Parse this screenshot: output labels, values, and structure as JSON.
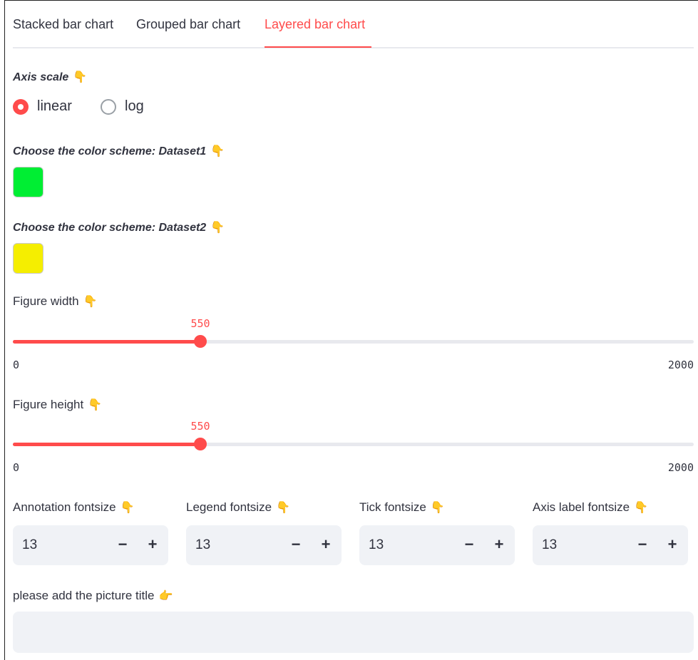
{
  "tabs": [
    {
      "label": "Stacked bar chart",
      "active": false
    },
    {
      "label": "Grouped bar chart",
      "active": false
    },
    {
      "label": "Layered bar chart",
      "active": true
    }
  ],
  "axis_scale": {
    "label": "Axis scale",
    "options": [
      "linear",
      "log"
    ],
    "selected": "linear"
  },
  "color_dataset1": {
    "label": "Choose the color scheme: Dataset1",
    "color": "#00ee33"
  },
  "color_dataset2": {
    "label": "Choose the color scheme: Dataset2",
    "color": "#f5ee00"
  },
  "figure_width": {
    "label": "Figure width",
    "value": 550,
    "min": 0,
    "max": 2000
  },
  "figure_height": {
    "label": "Figure height",
    "value": 550,
    "min": 0,
    "max": 2000
  },
  "number_inputs": [
    {
      "label": "Annotation fontsize",
      "value": "13",
      "minus": "−",
      "plus": "+"
    },
    {
      "label": "Legend fontsize",
      "value": "13",
      "minus": "−",
      "plus": "+"
    },
    {
      "label": "Tick fontsize",
      "value": "13",
      "minus": "−",
      "plus": "+"
    },
    {
      "label": "Axis label fontsize",
      "value": "13",
      "minus": "−",
      "plus": "+"
    }
  ],
  "title_input": {
    "label": "please add the picture title",
    "value": ""
  },
  "icons": {
    "label_pointer": "pointing-down-hand-icon",
    "title_pointer": "pointing-right-hand-icon"
  },
  "colors": {
    "accent": "#ff4b4b",
    "text": "#31333f",
    "input_bg": "#f0f2f6"
  }
}
